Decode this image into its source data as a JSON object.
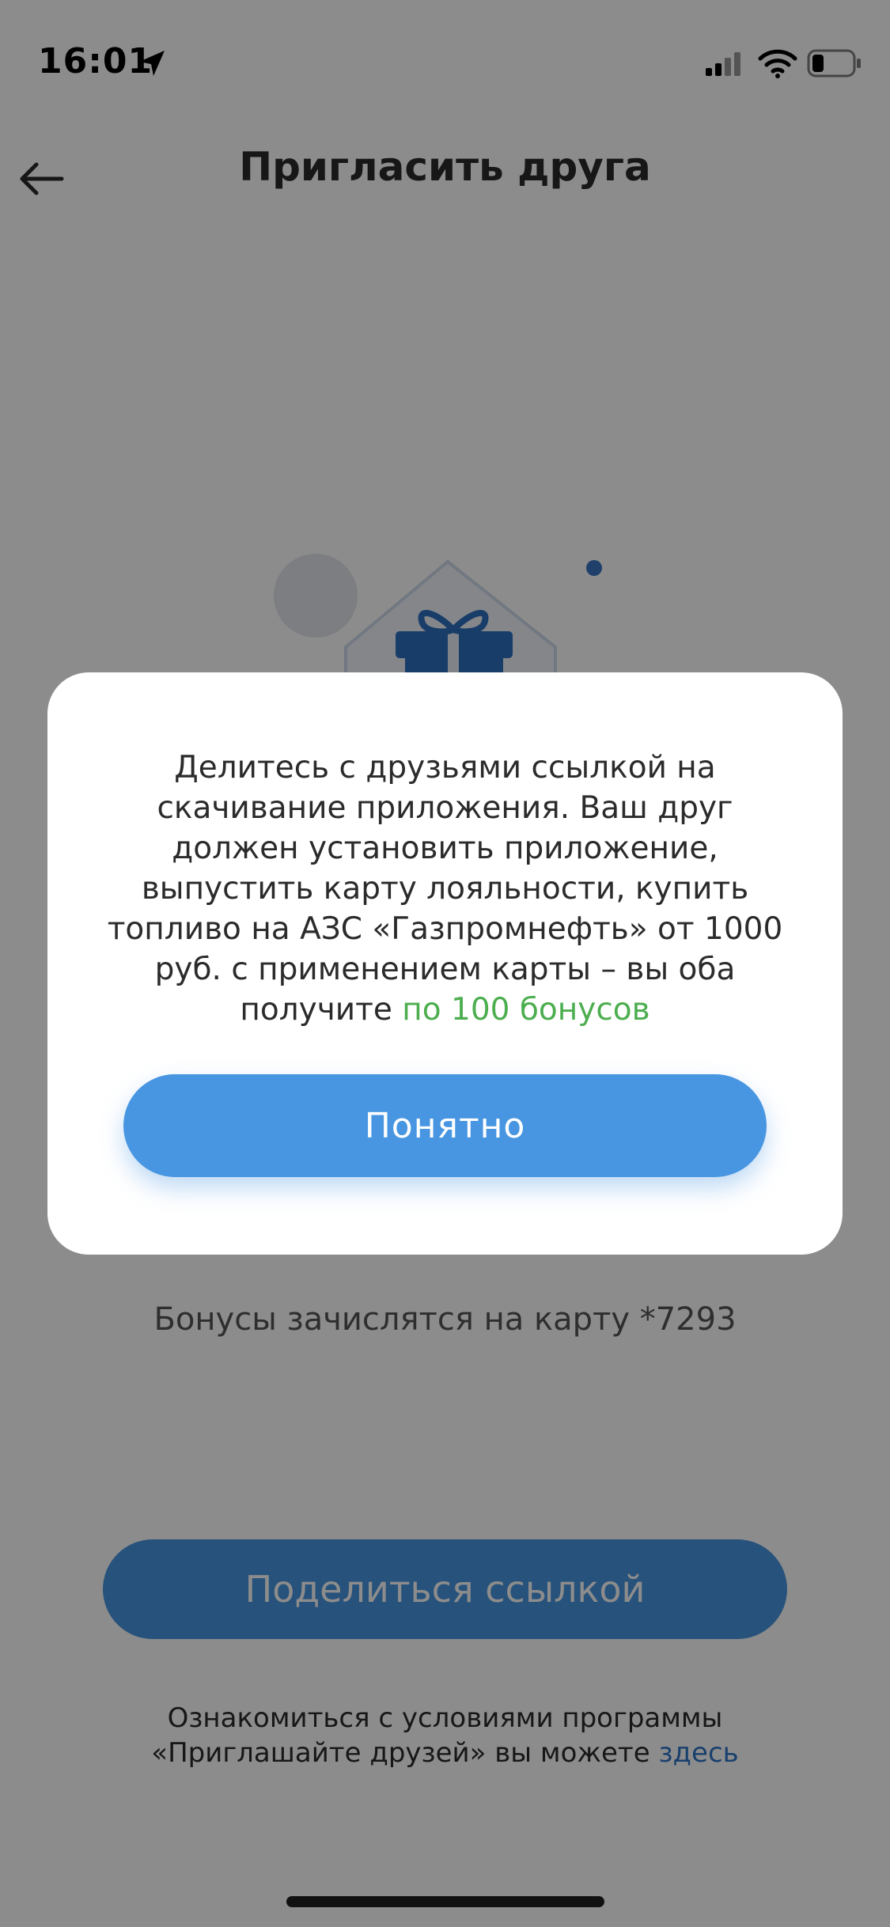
{
  "status_bar": {
    "time": "16:01"
  },
  "header": {
    "title": "Пригласить друга"
  },
  "bonus_info": "Бонусы зачислятся на карту *7293",
  "share_button": "Поделиться ссылкой",
  "terms": {
    "line1": "Ознакомиться с условиями программы",
    "line2": "«Приглашайте друзей» вы можете",
    "link": "здесь"
  },
  "modal": {
    "text": "Делитесь с друзьями ссылкой на скачивание приложения. Ваш друг должен установить приложение, выпустить карту лояльности, купить топливо на АЗС «Газпромнефть» от 1000 руб. с применением карты – вы оба получите",
    "highlight": "по 100 бонусов",
    "button": "Понятно"
  },
  "colors": {
    "accent": "#4896e1",
    "highlight_green": "#4cae4f",
    "link_blue": "#2f76c6",
    "overlay": "rgba(0,0,0,0.45)"
  },
  "icons": [
    "location-arrow-icon",
    "cellular-signal-icon",
    "wifi-icon",
    "battery-icon",
    "back-arrow-icon",
    "gift-envelope-icon"
  ]
}
